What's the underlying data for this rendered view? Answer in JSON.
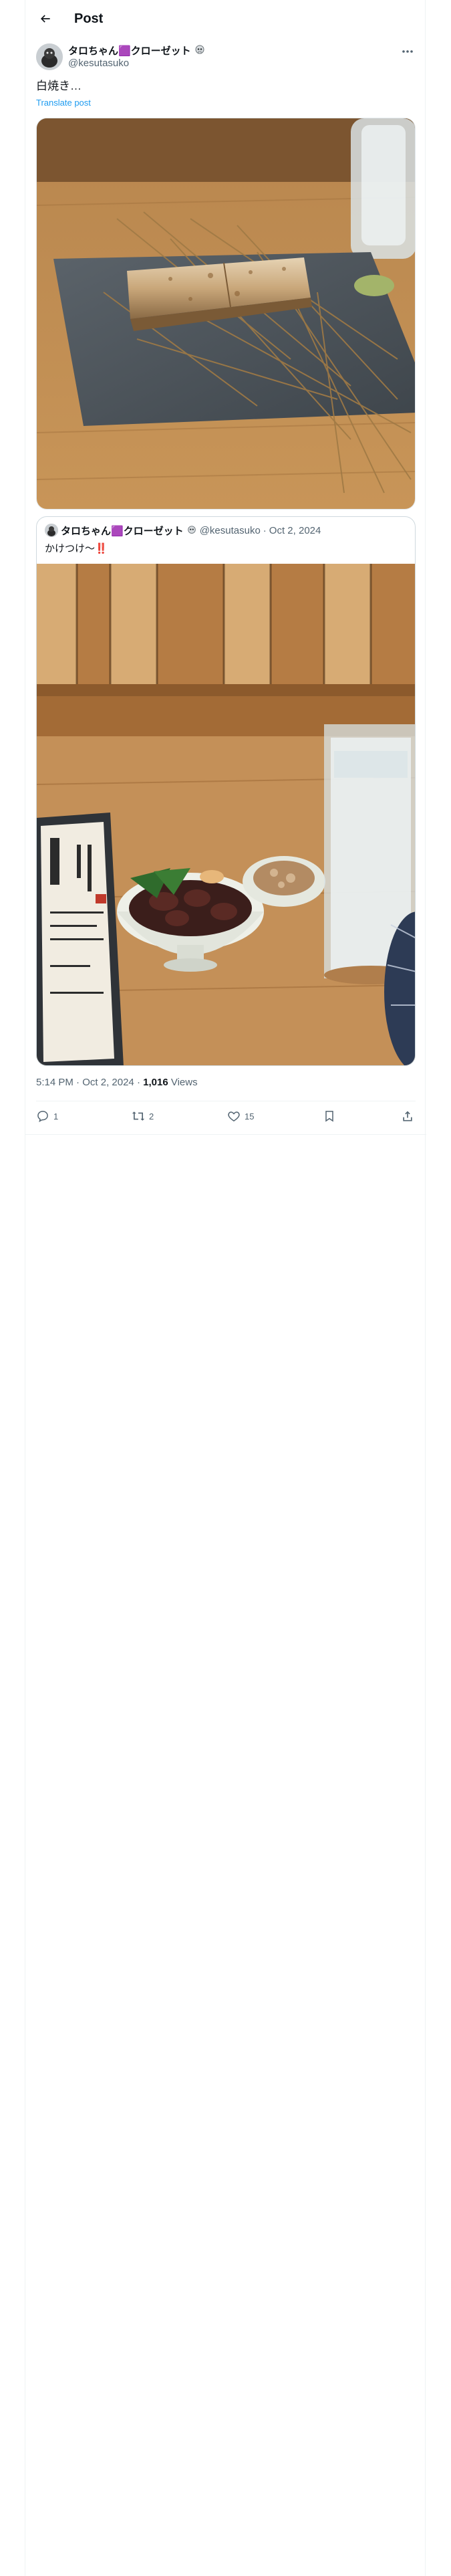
{
  "header": {
    "title": "Post"
  },
  "post": {
    "author_name": "タロちゃん🟪クローゼット",
    "author_handle": "@kesutasuko",
    "text": "白焼き…",
    "translate_label": "Translate post",
    "image_alt": "grilled eel on a slate plate"
  },
  "quote": {
    "author_name": "タロちゃん🟪クローゼット",
    "author_handle": "@kesutasuko",
    "separator": "·",
    "date": "Oct 2, 2024",
    "text": "かけつけ〜‼️",
    "image_alt": "liver dish, glass of drink and menu"
  },
  "meta": {
    "time": "5:14 PM",
    "separator": "·",
    "date": "Oct 2, 2024",
    "views_count": "1,016",
    "views_label": "Views"
  },
  "actions": {
    "replies": "1",
    "reposts": "2",
    "likes": "15"
  },
  "colors": {
    "accent": "#1d9bf0",
    "text": "#0f1419",
    "muted": "#536471",
    "border": "#eff3f4"
  },
  "icons": [
    "back-arrow-icon",
    "more-icon",
    "reply-icon",
    "repost-icon",
    "like-icon",
    "bookmark-icon",
    "share-icon"
  ]
}
